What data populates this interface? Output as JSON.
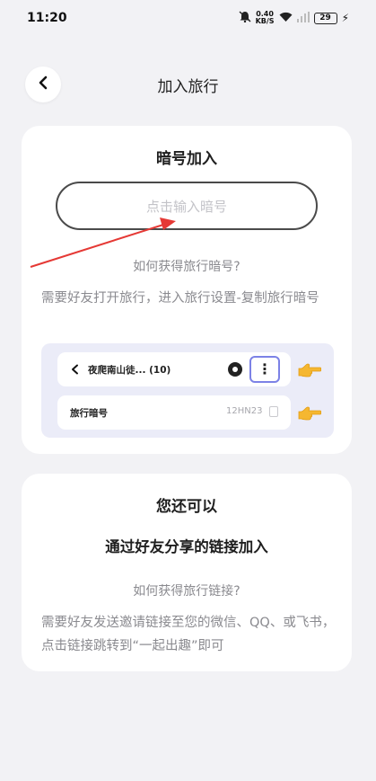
{
  "status_bar": {
    "time": "11:20",
    "icons": [
      "mute-icon",
      "network-speed-icon",
      "wifi-icon",
      "signal-icon",
      "battery-icon",
      "charging-icon"
    ],
    "net_speed_top": "0.40",
    "net_speed_bottom": "KB/S",
    "battery": "29"
  },
  "nav": {
    "title": "加入旅行",
    "back_icon": "chevron-left-icon"
  },
  "join_card": {
    "title": "暗号加入",
    "input_placeholder": "点击输入暗号",
    "hint_title": "如何获得旅行暗号?",
    "hint_text": "需要好友打开旅行，进入旅行设置-复制旅行暗号",
    "demo": {
      "trip_name": "夜爬南山徒... (10)",
      "code_label": "旅行暗号",
      "code_value": "12HN23"
    }
  },
  "link_card": {
    "title": "您还可以",
    "subtitle": "通过好友分享的链接加入",
    "hint_title": "如何获得旅行链接?",
    "hint_text": "需要好友发送邀请链接至您的微信、QQ、或飞书，点击链接跳转到“一起出趣”即可"
  },
  "colors": {
    "background": "#f2f2f5",
    "card": "#ffffff",
    "demo_bg": "#ebecf8",
    "highlight": "#7c82e6",
    "hand": "#f5b731",
    "annotation_arrow": "#e53935"
  }
}
